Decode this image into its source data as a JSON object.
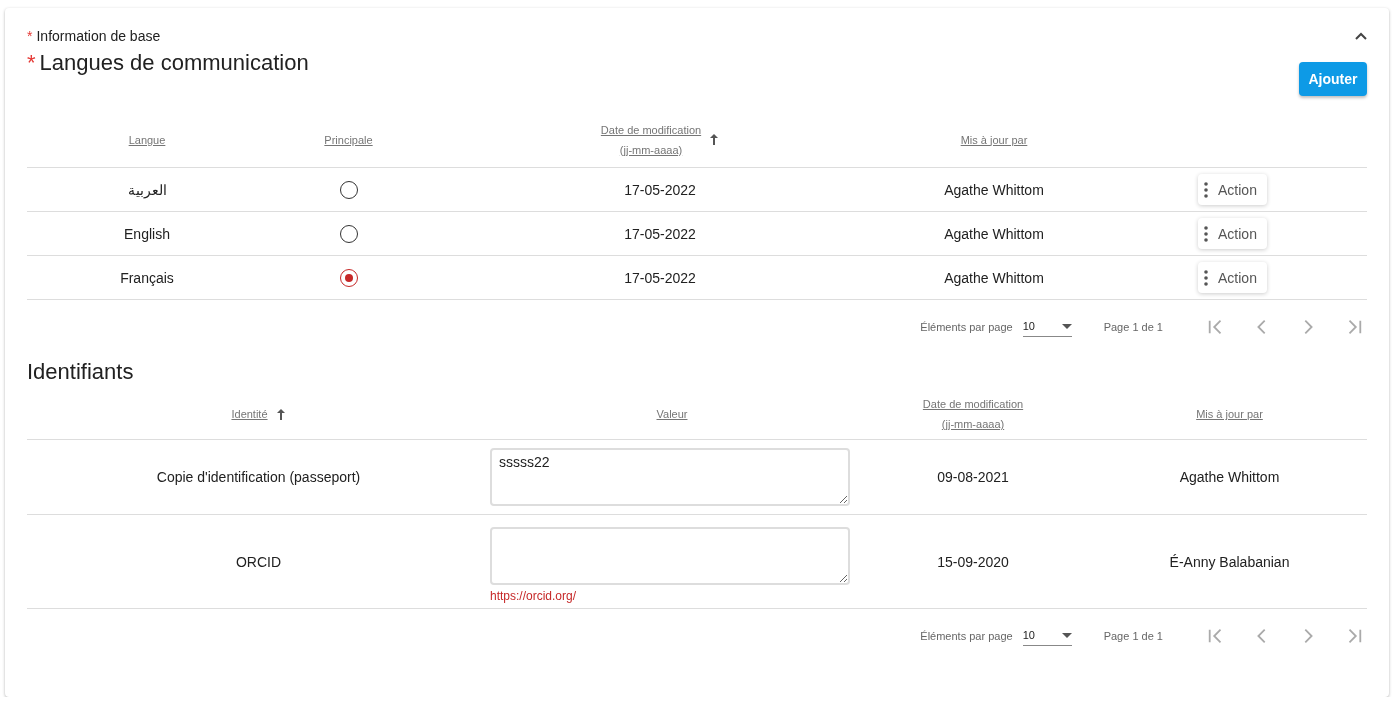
{
  "section": {
    "required_mark": "*",
    "title": "Information de base",
    "expanded": true
  },
  "languages": {
    "required_mark": "*",
    "title": "Langues de communication",
    "add_button": "Ajouter",
    "columns": [
      {
        "label": "Langue",
        "sorted": false
      },
      {
        "label": "Principale",
        "sorted": false
      },
      {
        "label": "Date de modification",
        "sublabel": "(jj-mm-aaaa)",
        "sorted": true
      },
      {
        "label": "Mis à jour par",
        "sorted": false
      }
    ],
    "rows": [
      {
        "language": "العربية",
        "selected": false,
        "date": "17-05-2022",
        "updated_by": "Agathe Whittom",
        "action": "Action"
      },
      {
        "language": "English",
        "selected": false,
        "date": "17-05-2022",
        "updated_by": "Agathe Whittom",
        "action": "Action"
      },
      {
        "language": "Français",
        "selected": true,
        "date": "17-05-2022",
        "updated_by": "Agathe Whittom",
        "action": "Action"
      }
    ],
    "paginator": {
      "items_label": "Éléments par page",
      "page_size": "10",
      "range": "Page 1 de 1"
    }
  },
  "identifiers": {
    "title": "Identifiants",
    "columns": [
      {
        "label": "Identité",
        "sorted": true
      },
      {
        "label": "Valeur",
        "sorted": false
      },
      {
        "label": "Date de modification",
        "sublabel": "(jj-mm-aaaa)",
        "sorted": false
      },
      {
        "label": "Mis à jour par",
        "sorted": false
      }
    ],
    "rows": [
      {
        "identity": "Copie d'identification (passeport)",
        "value": "sssss22",
        "date": "09-08-2021",
        "updated_by": "Agathe Whittom"
      },
      {
        "identity": "ORCID",
        "value": "",
        "hint": "https://orcid.org/",
        "date": "15-09-2020",
        "updated_by": "É-Anny Balabanian"
      }
    ],
    "paginator": {
      "items_label": "Éléments par page",
      "page_size": "10",
      "range": "Page 1 de 1"
    }
  }
}
